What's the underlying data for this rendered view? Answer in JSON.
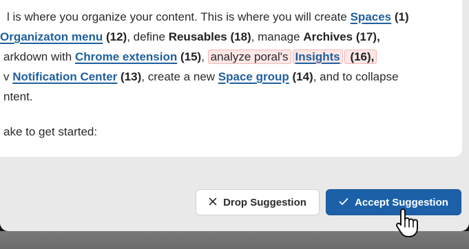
{
  "content": {
    "line1": {
      "text_a": "l is where you organize your content. This is where you will create ",
      "link_spaces": "Spaces",
      "num_spaces": " (1)"
    },
    "line2": {
      "link_org_menu": "Organizaton menu",
      "num_org": " (12)",
      "text_define": ", define ",
      "b_reusables": "Reusables (18)",
      "text_manage": ", manage ",
      "b_archives": "Archives (17),"
    },
    "line3": {
      "text_markdown": "arkdown with ",
      "link_chrome": "Chrome extension",
      "num_chrome": " (15)",
      "text_comma": ", ",
      "suggestion_analyze": "analyze poral's",
      "link_insights": "Insights",
      "num_insights": " (16),"
    },
    "line4": {
      "text_v": "v ",
      "link_notification": "Notification Center",
      "num_notification": " (13)",
      "text_create": ", create a new ",
      "link_space_group": "Space group",
      "num_space_group": " (14)",
      "text_collapse": ", and to collapse"
    },
    "line5": {
      "text": "ntent."
    },
    "line6": {
      "text": "ake to get started:"
    }
  },
  "actions": {
    "drop_label": "Drop Suggestion",
    "accept_label": "Accept Suggestion"
  },
  "icons": {
    "drop": "close-icon",
    "accept": "check-icon",
    "cursor": "hand-pointer-cursor"
  },
  "colors": {
    "link": "#1f5f9e",
    "accept_bg": "#1c61a8",
    "suggestion_bg": "#fde7e7"
  }
}
